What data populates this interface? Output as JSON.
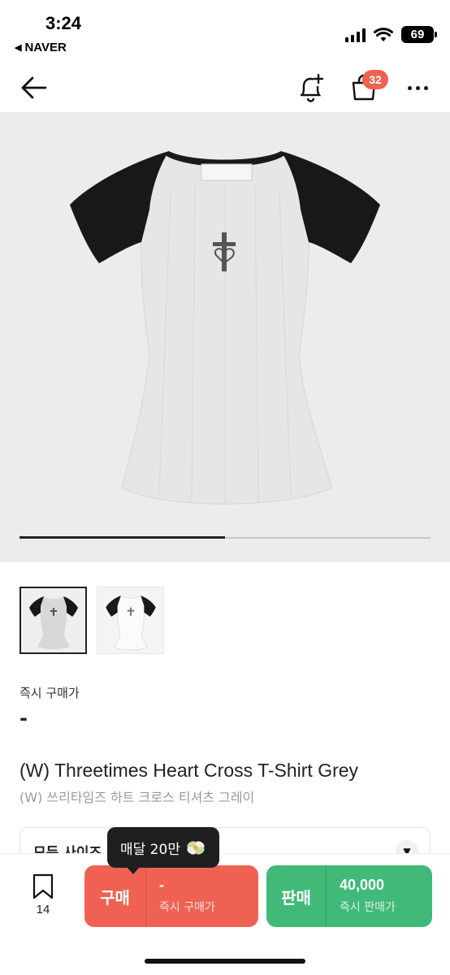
{
  "status_bar": {
    "time": "3:24",
    "back_app": "NAVER",
    "battery": "69"
  },
  "nav": {
    "cart_badge": "32"
  },
  "gallery": {
    "progress_fraction": 0.5,
    "thumbnail_count": 2
  },
  "product": {
    "price_label": "즉시 구매가",
    "price_value": "-",
    "title_en": "(W) Threetimes Heart Cross T-Shirt Grey",
    "title_ko": "(W) 쓰리타임즈 하트 크로스 티셔츠 그레이"
  },
  "size_select": {
    "label": "모든 사이즈"
  },
  "tooltip": {
    "text": "매달 20만"
  },
  "bottom_bar": {
    "bookmark_count": "14",
    "buy": {
      "label": "구매",
      "price": "-",
      "note": "즉시 구매가"
    },
    "sell": {
      "label": "판매",
      "price": "40,000",
      "note": "즉시 판매가"
    }
  },
  "colors": {
    "buy": "#ef6253",
    "sell": "#41b979",
    "badge": "#ef6253",
    "tooltip": "#1f1f1f"
  }
}
